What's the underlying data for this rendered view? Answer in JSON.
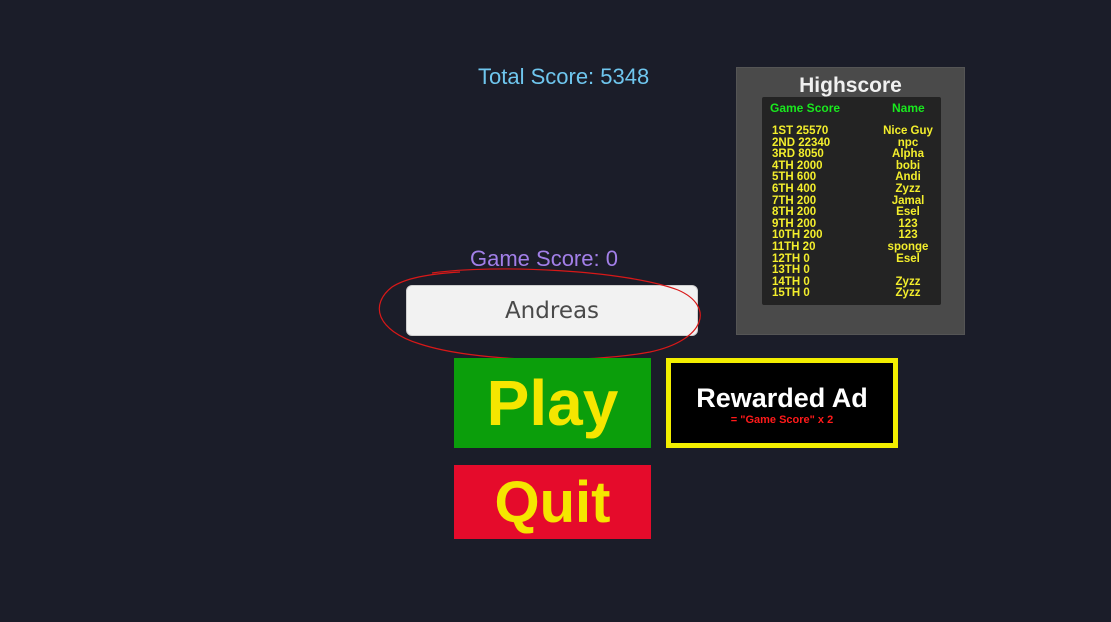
{
  "total_score": {
    "label": "Total Score:",
    "value": "5348"
  },
  "game_score": {
    "label": "Game Score:",
    "value": "0"
  },
  "name_input": {
    "value": "Andreas"
  },
  "buttons": {
    "play": "Play",
    "quit": "Quit",
    "rewarded_ad": {
      "title": "Rewarded Ad",
      "subtitle": "= \"Game Score\" x 2"
    }
  },
  "highscore": {
    "title": "Highscore",
    "col_score": "Game Score",
    "col_name": "Name",
    "rows": [
      {
        "rank": "1ST 25570",
        "name": "Nice Guy"
      },
      {
        "rank": "2ND 22340",
        "name": "npc"
      },
      {
        "rank": "3RD 8050",
        "name": "Alpha"
      },
      {
        "rank": "4TH 2000",
        "name": "bobi"
      },
      {
        "rank": "5TH 600",
        "name": "Andi"
      },
      {
        "rank": "6TH 400",
        "name": "Zyzz"
      },
      {
        "rank": "7TH 200",
        "name": "Jamal"
      },
      {
        "rank": "8TH 200",
        "name": "Esel"
      },
      {
        "rank": "9TH 200",
        "name": "123"
      },
      {
        "rank": "10TH 200",
        "name": "123"
      },
      {
        "rank": "11TH 20",
        "name": "sponge"
      },
      {
        "rank": "12TH 0",
        "name": "Esel"
      },
      {
        "rank": "13TH 0",
        "name": ""
      },
      {
        "rank": "14TH 0",
        "name": "Zyzz"
      },
      {
        "rank": "15TH 0",
        "name": "Zyzz"
      }
    ]
  },
  "colors": {
    "background": "#1b1d29",
    "total_score": "#6fc6ee",
    "game_score": "#a27fe8",
    "play_bg": "#0b9e0b",
    "quit_bg": "#e50b2b",
    "button_text": "#f5e600",
    "ad_border": "#f2ee00",
    "ad_subtitle": "#ff1a1a",
    "annotation": "#d81818",
    "hs_header": "#19e81e",
    "hs_text": "#f3ee2c"
  }
}
